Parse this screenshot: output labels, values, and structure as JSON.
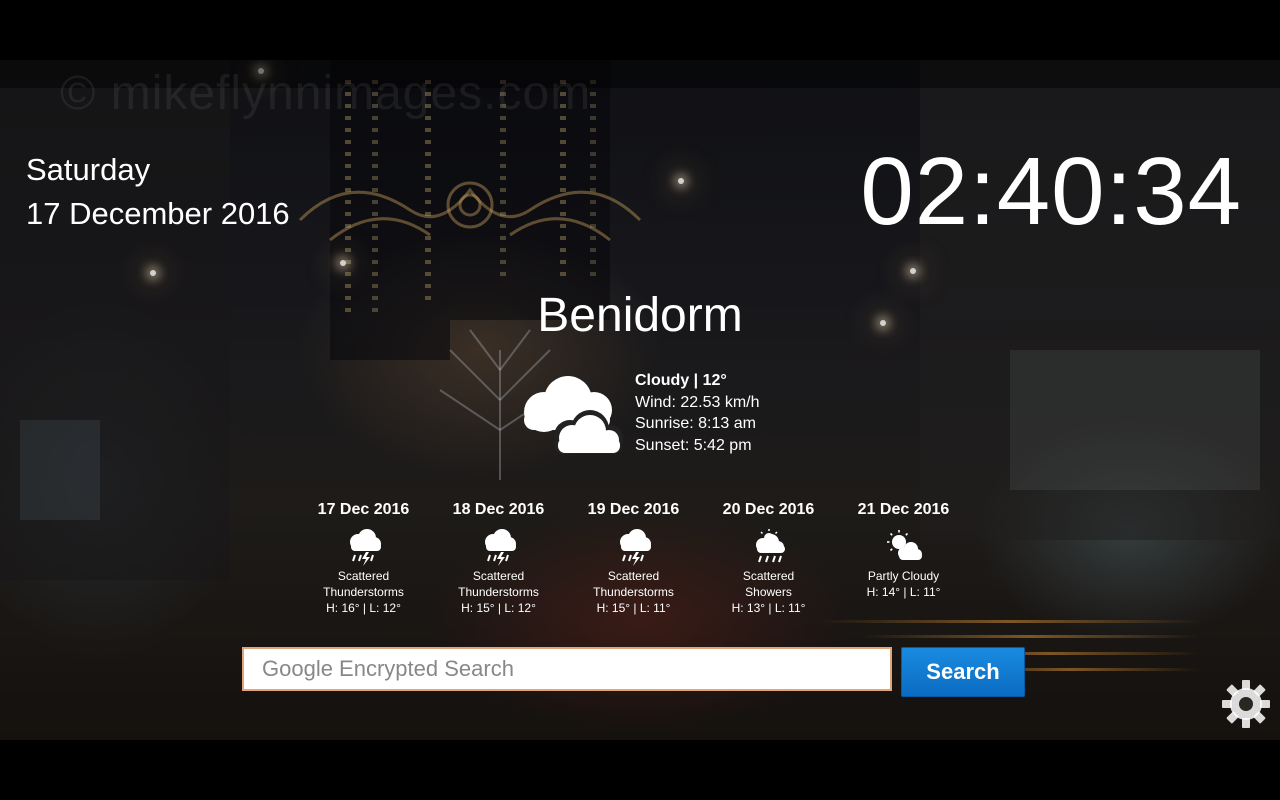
{
  "watermark": "© mikeflynnimages.com",
  "date": {
    "weekday": "Saturday",
    "full": "17 December 2016"
  },
  "clock": "02:40:34",
  "location": "Benidorm",
  "current": {
    "condition_line": "Cloudy | 12°",
    "wind": "Wind: 22.53 km/h",
    "sunrise": "Sunrise: 8:13 am",
    "sunset": "Sunset: 5:42 pm",
    "icon": "cloudy-icon"
  },
  "forecast": [
    {
      "date": "17 Dec 2016",
      "desc_line1": "Scattered",
      "desc_line2": "Thunderstorms",
      "temps": "H: 16° | L: 12°",
      "icon": "thunderstorm-icon"
    },
    {
      "date": "18 Dec 2016",
      "desc_line1": "Scattered",
      "desc_line2": "Thunderstorms",
      "temps": "H: 15° | L: 12°",
      "icon": "thunderstorm-icon"
    },
    {
      "date": "19 Dec 2016",
      "desc_line1": "Scattered",
      "desc_line2": "Thunderstorms",
      "temps": "H: 15° | L: 11°",
      "icon": "thunderstorm-icon"
    },
    {
      "date": "20 Dec 2016",
      "desc_line1": "Scattered",
      "desc_line2": "Showers",
      "temps": "H: 13° | L: 11°",
      "icon": "showers-icon"
    },
    {
      "date": "21 Dec 2016",
      "desc_line1": "Partly Cloudy",
      "desc_line2": "",
      "temps": "H: 14° | L: 11°",
      "icon": "partly-cloudy-icon"
    }
  ],
  "search": {
    "placeholder": "Google Encrypted Search",
    "value": "",
    "button_label": "Search"
  },
  "settings": {
    "icon": "gear-icon"
  },
  "colors": {
    "search_button": "#0a6cc2",
    "input_border": "#e2a57a",
    "text": "#ffffff"
  }
}
